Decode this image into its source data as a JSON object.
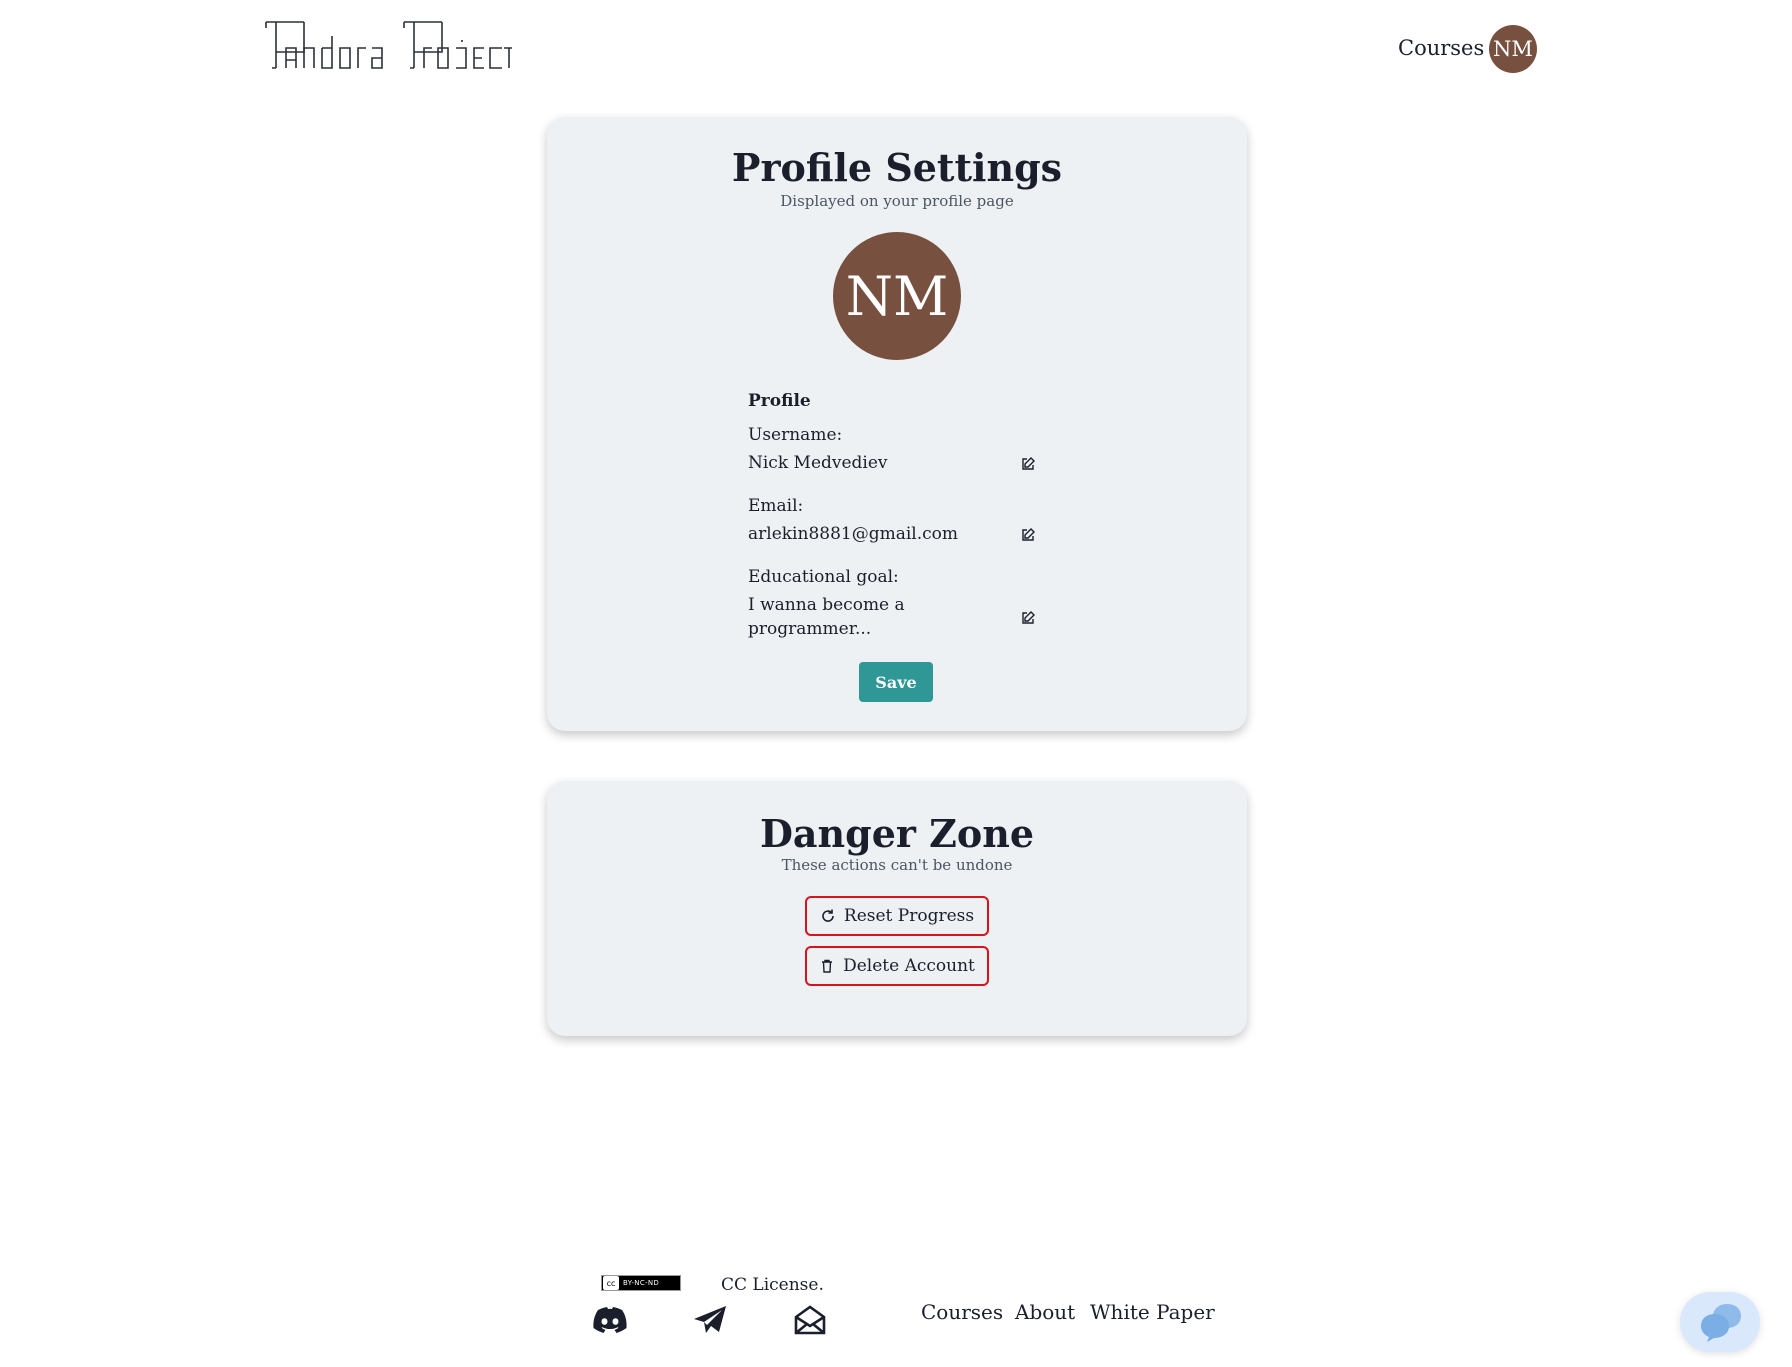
{
  "header": {
    "logo_alt": "Pandora Project",
    "nav_courses": "Courses",
    "avatar_initials": "NM"
  },
  "profile_card": {
    "title": "Profile Settings",
    "subtitle": "Displayed on your profile page",
    "avatar_initials": "NM",
    "section_label": "Profile",
    "fields": [
      {
        "label": "Username:",
        "value": "Nick Medvediev",
        "icon": "edit-icon"
      },
      {
        "label": "Email:",
        "value": "arlekin8881@gmail.com",
        "icon": "edit-icon"
      },
      {
        "label": "Educational goal:",
        "value": "I wanna become a programmer...",
        "icon": "edit-icon"
      }
    ],
    "save_label": "Save"
  },
  "danger_card": {
    "title": "Danger Zone",
    "subtitle": "These actions can't be undone",
    "reset_label": "Reset Progress",
    "reset_icon": "refresh-icon",
    "delete_label": "Delete Account",
    "delete_icon": "trash-icon"
  },
  "footer": {
    "cc_badge": "BY-NC-ND",
    "cc_license": "CC License.",
    "social_icons": [
      "discord-icon",
      "telegram-icon",
      "mail-icon"
    ],
    "links": [
      "Courses",
      "About",
      "White Paper"
    ]
  },
  "colors": {
    "accent": "#2f9795",
    "avatar": "#785040",
    "danger": "#d6131b",
    "card_bg": "#edf1f4"
  }
}
